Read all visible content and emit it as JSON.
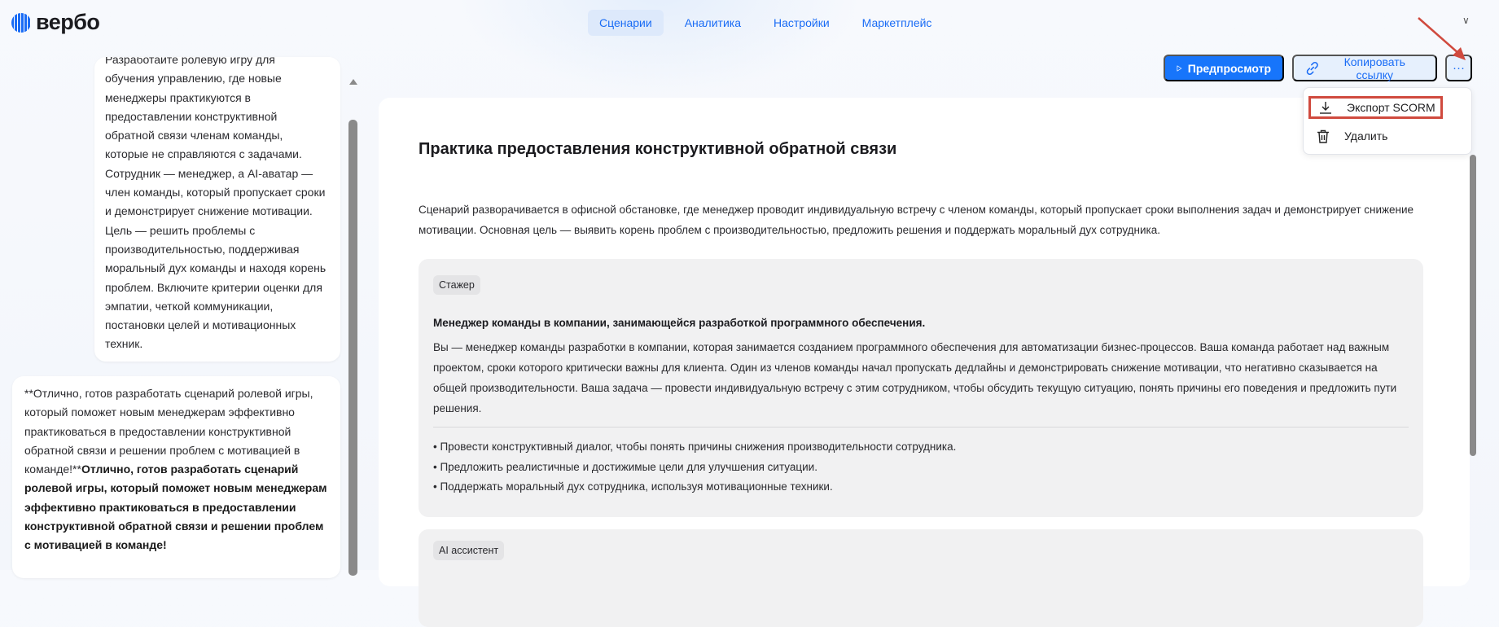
{
  "brand": {
    "name": "вербо"
  },
  "nav": {
    "items": [
      {
        "label": "Сценарии",
        "active": true
      },
      {
        "label": "Аналитика"
      },
      {
        "label": "Настройки"
      },
      {
        "label": "Маркетплейс"
      }
    ]
  },
  "toolbar": {
    "preview": "Предпросмотр",
    "copy_link": "Копировать ссылку",
    "more": "···"
  },
  "menu": {
    "export": "Экспорт SCORM",
    "delete": "Удалить"
  },
  "chat": {
    "user_message": "Разработайте ролевую игру для обучения управлению, где новые менеджеры практикуются в предоставлении конструктивной обратной связи членам команды, которые не справляются с задачами. Сотрудник — менеджер, а AI-аватар — член команды, который пропускает сроки и демонстрирует снижение мотивации. Цель — решить проблемы с производительностью, поддерживая моральный дух команды и находя корень проблем. Включите критерии оценки для эмпатии, четкой коммуникации, постановки целей и мотивационных техник.",
    "assistant_plain": "**Отлично, готов разработать сценарий ролевой игры, который поможет новым менеджерам эффективно практиковаться в предоставлении конструктивной обратной связи и решении проблем с мотивацией в команде!**",
    "assistant_bold": "Отлично, готов разработать сценарий ролевой игры, который поможет новым менеджерам эффективно практиковаться в предоставлении конструктивной обратной связи и решении проблем с мотивацией в команде!"
  },
  "scenario": {
    "title": "Практика предоставления конструктивной обратной связи",
    "description": "Сценарий разворачивается в офисной обстановке, где менеджер проводит индивидуальную встречу с членом команды, который пропускает сроки выполнения задач и демонстрирует снижение мотивации. Основная цель — выявить корень проблем с производительностью, предложить решения и поддержать моральный дух сотрудника.",
    "trainee": {
      "tag": "Стажер",
      "heading": "Менеджер команды в компании, занимающейся разработкой программного обеспечения.",
      "text": "Вы — менеджер команды разработки в компании, которая занимается созданием программного обеспечения для автоматизации бизнес-процессов. Ваша команда работает над важным проектом, сроки которого критически важны для клиента. Один из членов команды начал пропускать дедлайны и демонстрировать снижение мотивации, что негативно сказывается на общей производительности. Ваша задача — провести индивидуальную встречу с этим сотрудником, чтобы обсудить текущую ситуацию, понять причины его поведения и предложить пути решения.",
      "goals": [
        "• Провести конструктивный диалог, чтобы понять причины снижения производительности сотрудника.",
        "• Предложить реалистичные и достижимые цели для улучшения ситуации.",
        "• Поддержать моральный дух сотрудника, используя мотивационные техники."
      ]
    },
    "assistant": {
      "tag": "AI ассистент"
    }
  },
  "colors": {
    "accent": "#1775fb",
    "highlight": "#d04a3e"
  }
}
